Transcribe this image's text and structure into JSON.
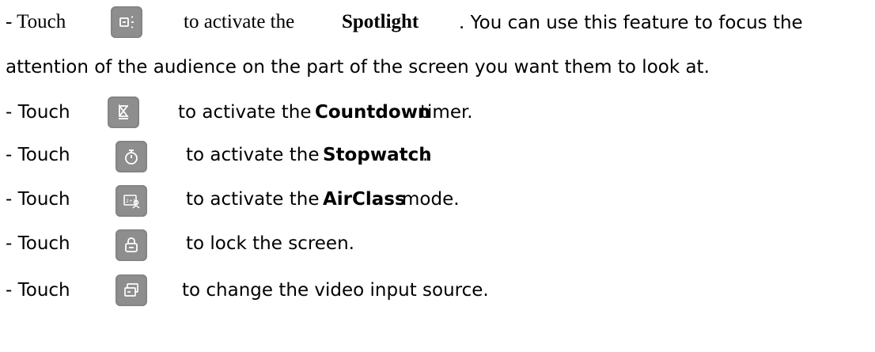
{
  "lines": [
    {
      "prefix": "- Touch",
      "icon": "spotlight-icon",
      "parts": [
        "to activate the ",
        "Spotlight",
        ". You can use this feature to focus the"
      ]
    },
    {
      "continuation": "attention of the audience on the part of the screen you want them to look at."
    },
    {
      "prefix": "- Touch",
      "icon": "hourglass-icon",
      "parts": [
        "to activate the ",
        "Countdown",
        " timer."
      ]
    },
    {
      "prefix": "- Touch",
      "icon": "stopwatch-icon",
      "parts": [
        "to activate the ",
        "Stopwatch",
        "."
      ]
    },
    {
      "prefix": "- Touch",
      "icon": "airclass-icon",
      "parts": [
        "to activate the ",
        "AirClass",
        " mode."
      ]
    },
    {
      "prefix": "- Touch",
      "icon": "lock-icon",
      "parts": [
        "to lock the screen."
      ]
    },
    {
      "prefix": "- Touch",
      "icon": "input-source-icon",
      "parts": [
        "to change the video input source."
      ]
    }
  ],
  "colors": {
    "icon_bg": "#8e8e8e",
    "icon_fg": "#ffffff"
  }
}
